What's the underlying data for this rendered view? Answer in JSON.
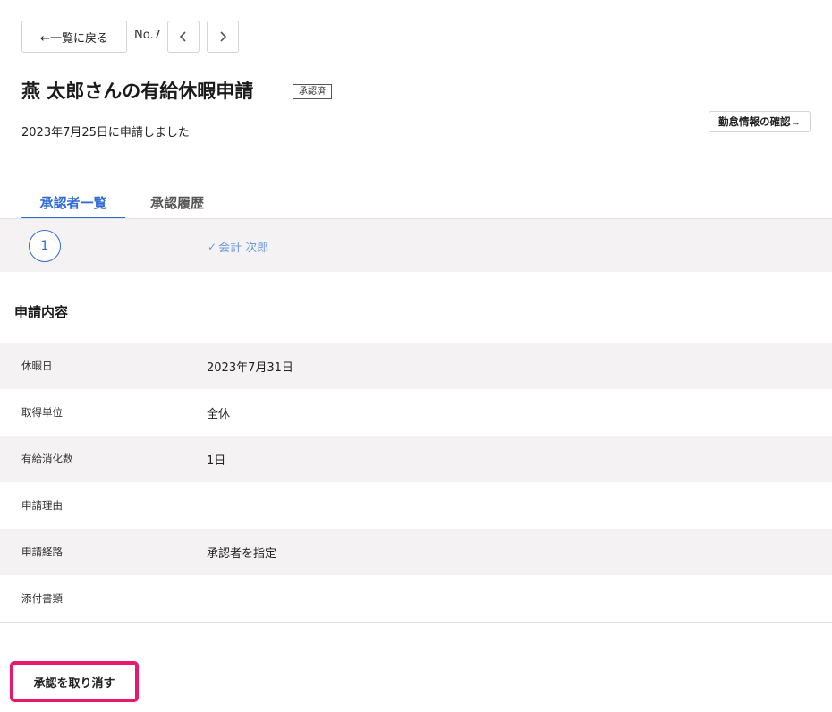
{
  "header": {
    "back_label": "←一覧に戻る",
    "record_no": "No.7"
  },
  "request": {
    "title": "燕 太郎さんの有給休暇申請",
    "status_badge": "承認済",
    "applied_text": "2023年7月25日に申請しました",
    "attendance_link": "勤怠情報の確認→"
  },
  "tabs": [
    {
      "label": "承認者一覧",
      "active": true
    },
    {
      "label": "承認履歴",
      "active": false
    }
  ],
  "approvers": [
    {
      "step": "1",
      "check": "✓",
      "name": "会計 次郎"
    }
  ],
  "details": {
    "section_title": "申請内容",
    "rows": [
      {
        "label": "休暇日",
        "value": "2023年7月31日"
      },
      {
        "label": "取得単位",
        "value": "全休"
      },
      {
        "label": "有給消化数",
        "value": "1日"
      },
      {
        "label": "申請理由",
        "value": ""
      },
      {
        "label": "申請経路",
        "value": "承認者を指定"
      },
      {
        "label": "添付書類",
        "value": ""
      }
    ]
  },
  "actions": {
    "cancel_label": "承認を取り消す"
  },
  "icons": {
    "prev": "chevron-left-icon",
    "next": "chevron-right-icon",
    "check": "check-icon"
  },
  "colors": {
    "accent": "#2f6bd6",
    "approver_text": "#6a9be0",
    "highlight": "#e8186d",
    "row_shade": "#f4f2f2"
  }
}
